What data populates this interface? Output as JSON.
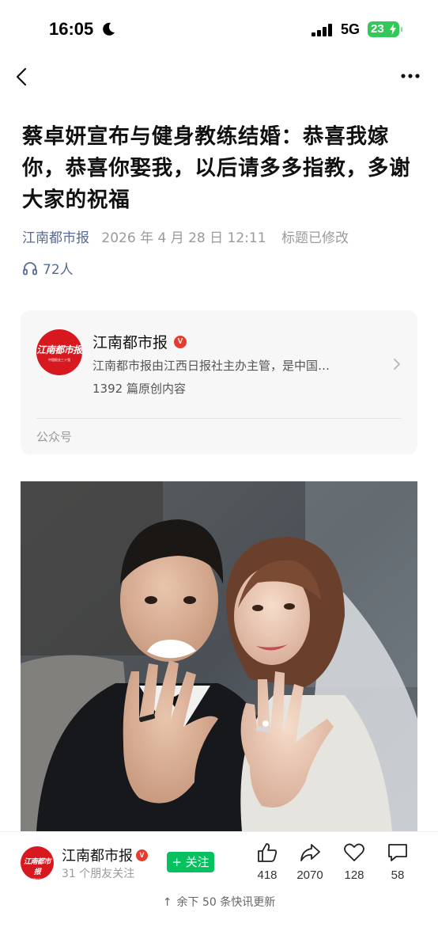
{
  "status_bar": {
    "time": "16:05",
    "network": "5G",
    "battery": "23"
  },
  "article": {
    "title": "蔡卓妍宣布与健身教练结婚：恭喜我嫁你，恭喜你娶我，以后请多多指教，多谢大家的祝福",
    "source": "江南都市报",
    "date": "2026 年 4 月 28 日 12:11",
    "edited": "标题已修改",
    "listeners": "72人"
  },
  "account_card": {
    "name": "江南都市报",
    "verified": "V",
    "description": "江南都市报由江西日报社主办主管，是中国…",
    "original_count": "1392 篇原创内容",
    "type_label": "公众号",
    "logo_text": "江南都市报",
    "logo_subtext": "中国报业三十强"
  },
  "bottom_bar": {
    "name": "江南都市报",
    "verified": "V",
    "friends_following": "31 个朋友关注",
    "follow_label": "+ 关注",
    "actions": [
      {
        "icon": "thumbs-up-icon",
        "count": "418"
      },
      {
        "icon": "share-icon",
        "count": "2070"
      },
      {
        "icon": "heart-icon",
        "count": "128"
      },
      {
        "icon": "comment-icon",
        "count": "58"
      }
    ],
    "updates_arrow": "↑",
    "updates_text": "余下 50 条快讯更新"
  },
  "colors": {
    "link": "#576b95",
    "brand_red": "#d8181f",
    "follow_green": "#07c160",
    "battery_green": "#34c759"
  }
}
